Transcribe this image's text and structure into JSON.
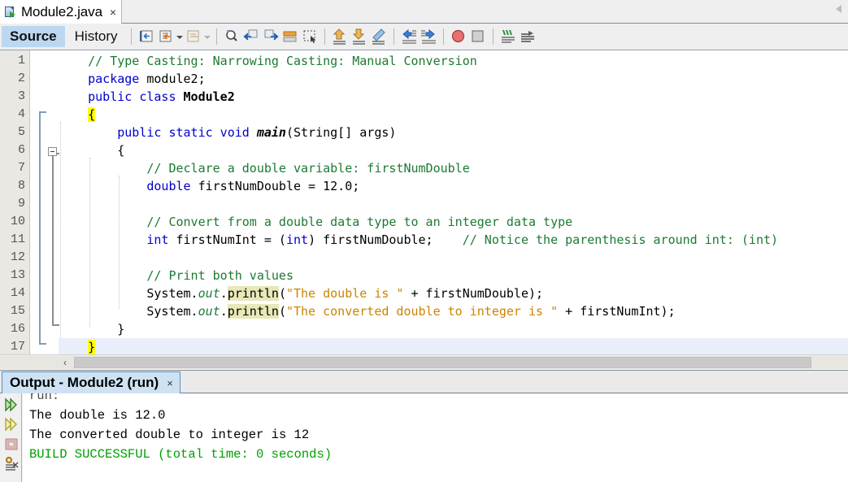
{
  "window": {
    "file_tab": {
      "label": "Module2.java",
      "close": "×",
      "icon": "java-file-icon"
    },
    "tab_scroll_icon": "scroll-left-icon"
  },
  "toolbar": {
    "view_tabs": [
      {
        "label": "Source",
        "selected": true
      },
      {
        "label": "History",
        "selected": false
      }
    ],
    "buttons": [
      {
        "name": "last-edit-icon"
      },
      {
        "name": "toggle-bookmark-icon"
      },
      {
        "name": "toggle-bookmark-dropdown-icon"
      },
      {
        "name": "previous-bookmark-icon"
      },
      {
        "name": "previous-bookmark-dropdown-icon"
      },
      {
        "name": "find-selection-icon"
      },
      {
        "name": "find-previous-icon"
      },
      {
        "name": "find-next-icon"
      },
      {
        "name": "toggle-highlight-icon"
      },
      {
        "name": "toggle-rectangular-selection-icon"
      },
      {
        "name": "previous-error-icon"
      },
      {
        "name": "next-error-icon"
      },
      {
        "name": "shift-line-left-icon"
      },
      {
        "name": "shift-line-right-icon"
      },
      {
        "name": "start-macro-recording-icon"
      },
      {
        "name": "stop-macro-recording-icon"
      },
      {
        "name": "comment-icon"
      },
      {
        "name": "uncomment-icon"
      }
    ]
  },
  "editor": {
    "current_line": 17,
    "lines": [
      {
        "n": 1,
        "segments": [
          {
            "t": "    ",
            "c": "plain"
          },
          {
            "t": "// Type Casting: Narrowing Casting: Manual Conversion",
            "c": "cmt"
          }
        ]
      },
      {
        "n": 2,
        "segments": [
          {
            "t": "    ",
            "c": "plain"
          },
          {
            "t": "package",
            "c": "kw"
          },
          {
            "t": " module2;",
            "c": "plain"
          }
        ]
      },
      {
        "n": 3,
        "segments": [
          {
            "t": "    ",
            "c": "plain"
          },
          {
            "t": "public class",
            "c": "kw"
          },
          {
            "t": " ",
            "c": "plain"
          },
          {
            "t": "Module2",
            "c": "cls"
          }
        ]
      },
      {
        "n": 4,
        "segments": [
          {
            "t": "    ",
            "c": "plain"
          },
          {
            "t": "{",
            "c": "hl-brace"
          }
        ]
      },
      {
        "n": 5,
        "segments": [
          {
            "t": "        ",
            "c": "plain"
          },
          {
            "t": "public static void",
            "c": "kw"
          },
          {
            "t": " ",
            "c": "plain"
          },
          {
            "t": "main",
            "c": "mth"
          },
          {
            "t": "(String[] args)",
            "c": "plain"
          }
        ]
      },
      {
        "n": 6,
        "segments": [
          {
            "t": "        {",
            "c": "plain"
          }
        ]
      },
      {
        "n": 7,
        "segments": [
          {
            "t": "            ",
            "c": "plain"
          },
          {
            "t": "// Declare a double variable: firstNumDouble",
            "c": "cmt"
          }
        ]
      },
      {
        "n": 8,
        "segments": [
          {
            "t": "            ",
            "c": "plain"
          },
          {
            "t": "double",
            "c": "kw"
          },
          {
            "t": " firstNumDouble = 12.0;",
            "c": "plain"
          }
        ]
      },
      {
        "n": 9,
        "segments": [
          {
            "t": "",
            "c": "plain"
          }
        ]
      },
      {
        "n": 10,
        "segments": [
          {
            "t": "            ",
            "c": "plain"
          },
          {
            "t": "// Convert from a double data type to an integer data type",
            "c": "cmt"
          }
        ]
      },
      {
        "n": 11,
        "segments": [
          {
            "t": "            ",
            "c": "plain"
          },
          {
            "t": "int",
            "c": "kw"
          },
          {
            "t": " firstNumInt = (",
            "c": "plain"
          },
          {
            "t": "int",
            "c": "kw"
          },
          {
            "t": ") firstNumDouble;    ",
            "c": "plain"
          },
          {
            "t": "// Notice the parenthesis around int: (int)",
            "c": "cmt"
          }
        ]
      },
      {
        "n": 12,
        "segments": [
          {
            "t": "",
            "c": "plain"
          }
        ]
      },
      {
        "n": 13,
        "segments": [
          {
            "t": "            ",
            "c": "plain"
          },
          {
            "t": "// Print both values",
            "c": "cmt"
          }
        ]
      },
      {
        "n": 14,
        "segments": [
          {
            "t": "            System.",
            "c": "plain"
          },
          {
            "t": "out",
            "c": "fld"
          },
          {
            "t": ".",
            "c": "plain"
          },
          {
            "t": "println",
            "c": "hl-ident"
          },
          {
            "t": "(",
            "c": "plain"
          },
          {
            "t": "\"The double is \"",
            "c": "str"
          },
          {
            "t": " + firstNumDouble);",
            "c": "plain"
          }
        ]
      },
      {
        "n": 15,
        "segments": [
          {
            "t": "            System.",
            "c": "plain"
          },
          {
            "t": "out",
            "c": "fld"
          },
          {
            "t": ".",
            "c": "plain"
          },
          {
            "t": "println",
            "c": "hl-ident"
          },
          {
            "t": "(",
            "c": "plain"
          },
          {
            "t": "\"The converted double to integer is \"",
            "c": "str"
          },
          {
            "t": " + firstNumInt);",
            "c": "plain"
          }
        ]
      },
      {
        "n": 16,
        "segments": [
          {
            "t": "        }",
            "c": "plain"
          }
        ]
      },
      {
        "n": 17,
        "segments": [
          {
            "t": "    ",
            "c": "plain"
          },
          {
            "t": "}",
            "c": "hl-brace"
          }
        ]
      }
    ],
    "scrollbar": {
      "left_arrow": "‹"
    }
  },
  "output": {
    "tab": {
      "label": "Output - Module2 (run)",
      "close": "×"
    },
    "gutter_icons": [
      {
        "name": "run-icon"
      },
      {
        "name": "debug-icon"
      },
      {
        "name": "stop-icon"
      },
      {
        "name": "settings-icon"
      }
    ],
    "lines": [
      {
        "text": "run:",
        "style": "muted"
      },
      {
        "text": "The double is 12.0",
        "style": "plain"
      },
      {
        "text": "The converted double to integer is 12",
        "style": "plain"
      },
      {
        "text": "BUILD SUCCESSFUL (total time: 0 seconds)",
        "style": "ok"
      }
    ]
  },
  "colors": {
    "keyword": "#0000cc",
    "comment": "#1c7a32",
    "string": "#cc8400",
    "brace_highlight": "#ffff00",
    "ident_highlight": "#e8e8b8",
    "current_line": "#e8eefa",
    "build_success": "#00a000",
    "tab_selected": "#cfe2f3"
  }
}
